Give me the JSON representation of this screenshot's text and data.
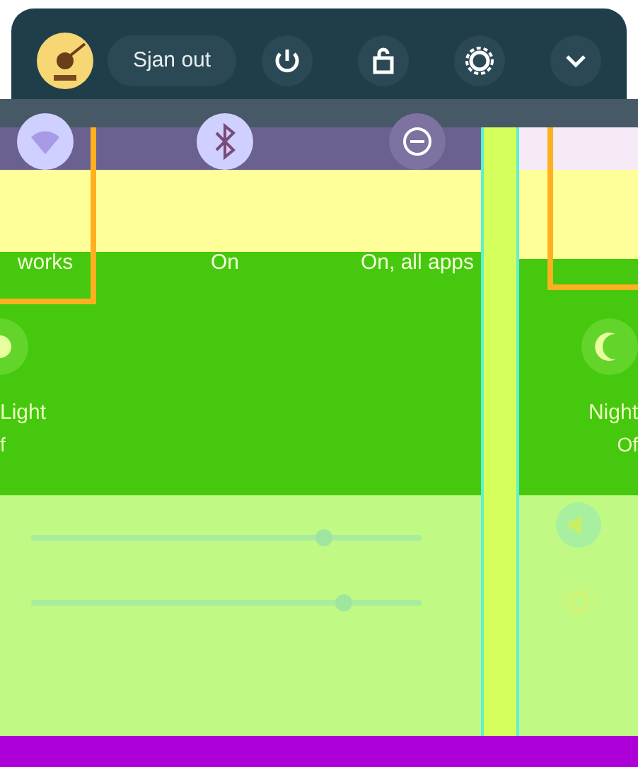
{
  "header": {
    "sign_out": "Sjan out"
  },
  "tiles": [
    {
      "subtitle": "works"
    },
    {
      "subtitle": "On"
    },
    {
      "subtitle": "On, all apps"
    }
  ],
  "night_light": {
    "title": "Light",
    "subtitle": "f"
  },
  "sliders": [
    {
      "level": 0.75
    },
    {
      "level": 0.8
    }
  ],
  "side_tile": {
    "title": "Night",
    "subtitle": "Of"
  }
}
